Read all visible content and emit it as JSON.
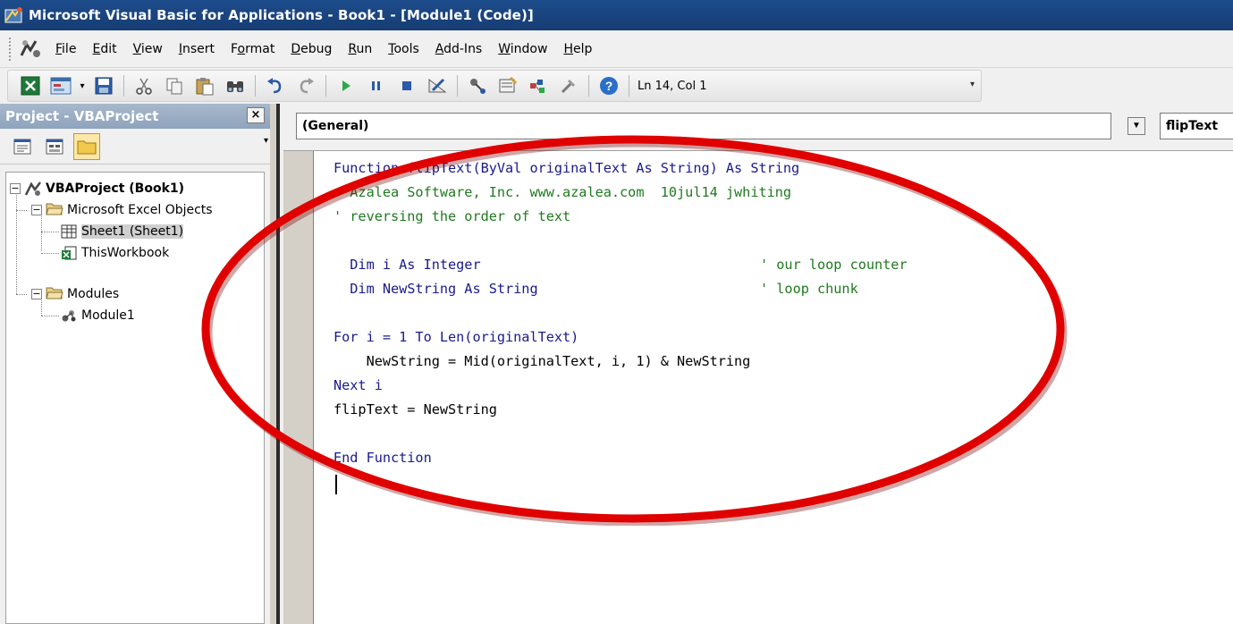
{
  "window": {
    "title": "Microsoft Visual Basic for Applications - Book1 - [Module1 (Code)]"
  },
  "menu": [
    {
      "pre": "",
      "ul": "F",
      "post": "ile"
    },
    {
      "pre": "",
      "ul": "E",
      "post": "dit"
    },
    {
      "pre": "",
      "ul": "V",
      "post": "iew"
    },
    {
      "pre": "",
      "ul": "I",
      "post": "nsert"
    },
    {
      "pre": "F",
      "ul": "o",
      "post": "rmat"
    },
    {
      "pre": "",
      "ul": "D",
      "post": "ebug"
    },
    {
      "pre": "",
      "ul": "R",
      "post": "un"
    },
    {
      "pre": "",
      "ul": "T",
      "post": "ools"
    },
    {
      "pre": "",
      "ul": "A",
      "post": "dd-Ins"
    },
    {
      "pre": "",
      "ul": "W",
      "post": "indow"
    },
    {
      "pre": "",
      "ul": "H",
      "post": "elp"
    }
  ],
  "toolbar": {
    "position": "Ln 14, Col 1",
    "icons": [
      "view-excel-icon",
      "insert-userform-icon",
      "dropdown-arrow-icon",
      "save-icon",
      "cut-icon",
      "copy-icon",
      "paste-icon",
      "find-icon",
      "undo-icon",
      "redo-icon",
      "run-icon",
      "break-icon",
      "reset-icon",
      "design-mode-icon",
      "project-explorer-icon",
      "properties-window-icon",
      "object-browser-icon",
      "toolbox-icon",
      "help-icon"
    ]
  },
  "project": {
    "header": "Project - VBAProject",
    "close": "×",
    "tree": {
      "root": "VBAProject (Book1)",
      "folder1": "Microsoft Excel Objects",
      "sheet1": "Sheet1 (Sheet1)",
      "workbook": "ThisWorkbook",
      "folder2": "Modules",
      "module1": "Module1"
    }
  },
  "code": {
    "object_combo": "(General)",
    "procedure_combo": "flipText",
    "lines": {
      "l1": "Function flipText(ByVal originalText As String) As String",
      "l2": "  Azalea Software, Inc. www.azalea.com  10jul14 jwhiting",
      "l3": "' reversing the order of text",
      "l5a": "  Dim i As Integer",
      "l5b": "' our loop counter",
      "l6a": "  Dim NewString As String",
      "l6b": "' loop chunk",
      "l8": "For i = 1 To Len(originalText)",
      "l9": "    NewString = Mid(originalText, i, 1) & NewString",
      "l10": "Next i",
      "l11": "flipText = NewString",
      "l13": "End Function"
    }
  },
  "colors": {
    "keyword": "#1a1a8c",
    "comment": "#1f7a1f",
    "annotation": "#e00000"
  }
}
